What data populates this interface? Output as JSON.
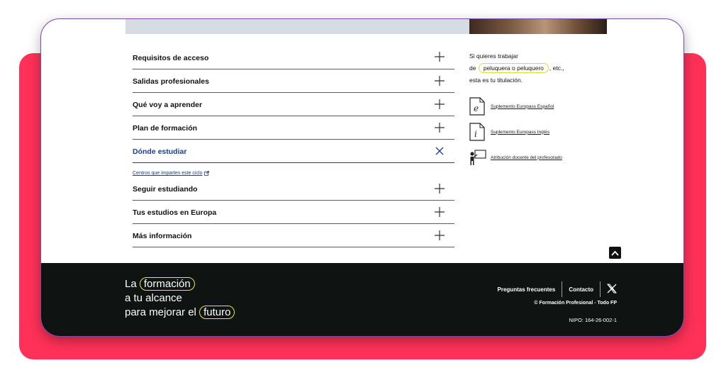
{
  "colors": {
    "accent_red": "#ff3158",
    "link_blue": "#1d3d8f",
    "highlight": "#e5ea2f",
    "footer_bg": "#0f1311"
  },
  "accordion": {
    "items": [
      {
        "label": "Requisitos de acceso",
        "icon": "plus-icon"
      },
      {
        "label": "Salidas profesionales",
        "icon": "plus-icon"
      },
      {
        "label": "Qué voy a aprender",
        "icon": "plus-icon"
      },
      {
        "label": "Plan de formación",
        "icon": "plus-icon"
      },
      {
        "label": "Dónde estudiar",
        "icon": "close-icon",
        "expanded": true
      }
    ],
    "sub_link": "Centros que imparten este ciclo",
    "items_after": [
      {
        "label": "Seguir estudiando",
        "icon": "plus-icon"
      },
      {
        "label": "Tus estudios en Europa",
        "icon": "plus-icon"
      },
      {
        "label": "Más información",
        "icon": "plus-icon"
      }
    ]
  },
  "promo": {
    "line1": "Si quieres trabajar",
    "prefix": "de",
    "highlight": "peluquera o peluquero",
    "suffix": ", etc.,",
    "line3": "esta es tu titulación."
  },
  "docs": [
    {
      "label": "Suplemento Europass Español",
      "icon": "document-e-icon"
    },
    {
      "label": "Suplemento Europass Inglés",
      "icon": "document-i-icon"
    },
    {
      "label": "Atribución docente del profesorado",
      "icon": "teacher-board-icon"
    }
  ],
  "footer": {
    "slogan_1a": "La",
    "slogan_1b": "formación",
    "slogan_2": "a tu alcance",
    "slogan_3a": "para mejorar el",
    "slogan_3b": "futuro",
    "link_faq": "Preguntas frecuentes",
    "link_contact": "Contacto",
    "copyright": "© Formación Profesional - Todo FP",
    "nipo": "NIPO: 164-26-002-1"
  }
}
